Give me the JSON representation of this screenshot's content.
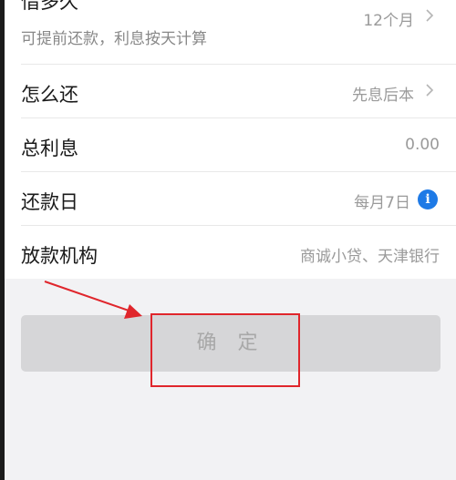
{
  "loan_form": {
    "rows": [
      {
        "label": "借多久",
        "sublabel": "可提前还款，利息按天计算",
        "value": "12个月"
      },
      {
        "label": "怎么还",
        "value": "先息后本"
      },
      {
        "label": "总利息",
        "value": "0.00"
      },
      {
        "label": "还款日",
        "value": "每月7日"
      },
      {
        "label": "放款机构",
        "value": "商诚小贷、天津银行"
      }
    ]
  },
  "confirm_button": {
    "label": "确 定"
  },
  "icons": {
    "chevron": "chevron-right-icon",
    "info": "info-icon"
  },
  "colors": {
    "info_accent": "#1e7ae6",
    "annotation": "#e0262c",
    "button_disabled": "#d6d6d8"
  }
}
